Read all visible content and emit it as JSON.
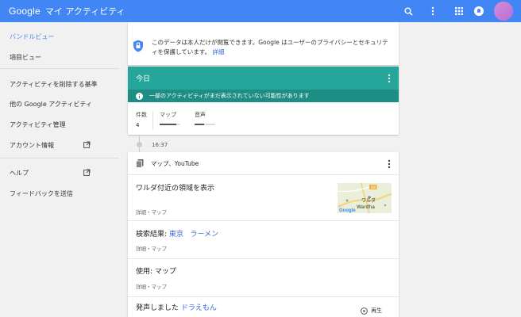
{
  "header": {
    "brand": "Google",
    "product": "マイ アクティビティ",
    "color": "#4285f4"
  },
  "sidebar": {
    "items": [
      {
        "label": "バンドルビュー"
      },
      {
        "label": "項目ビュー"
      },
      {
        "label": "アクティビティを削除する基準"
      },
      {
        "label": "他の Google アクティビティ"
      },
      {
        "label": "アクティビティ管理"
      },
      {
        "label": "アカウント情報"
      },
      {
        "label": "ヘルプ"
      },
      {
        "label": "フィードバックを送信"
      }
    ]
  },
  "notice": {
    "text": "このデータは本人だけが閲覧できます。Google はユーザーのプライバシーとセキュリティを保護しています。",
    "link": "詳細"
  },
  "today": {
    "title": "今日",
    "info": "一部のアクティビティがまだ表示されていない可能性があります",
    "stats": [
      {
        "label": "件数",
        "value": "4"
      },
      {
        "label": "マップ",
        "level": 0.8
      },
      {
        "label": "音声",
        "level": 0.45
      }
    ],
    "color": "#26a69a"
  },
  "timeline": {
    "time": "16:37"
  },
  "activity": {
    "header": "マップ、YouTube",
    "rows": [
      {
        "title": "ワルダ付近の領域を表示",
        "meta": "詳細・マップ",
        "map_label_jp": "ワルダ",
        "map_label_en": "Wardha",
        "map_logo": "Google",
        "road": "361"
      },
      {
        "prefix": "検索結果: ",
        "link1": "東京",
        "link2": "ラーメン",
        "meta": "詳細・マップ"
      },
      {
        "title": "使用: マップ",
        "meta": "詳細・マップ"
      },
      {
        "prefix": "発声しました ",
        "link1": "ドラえもん",
        "action": "再生"
      }
    ]
  }
}
